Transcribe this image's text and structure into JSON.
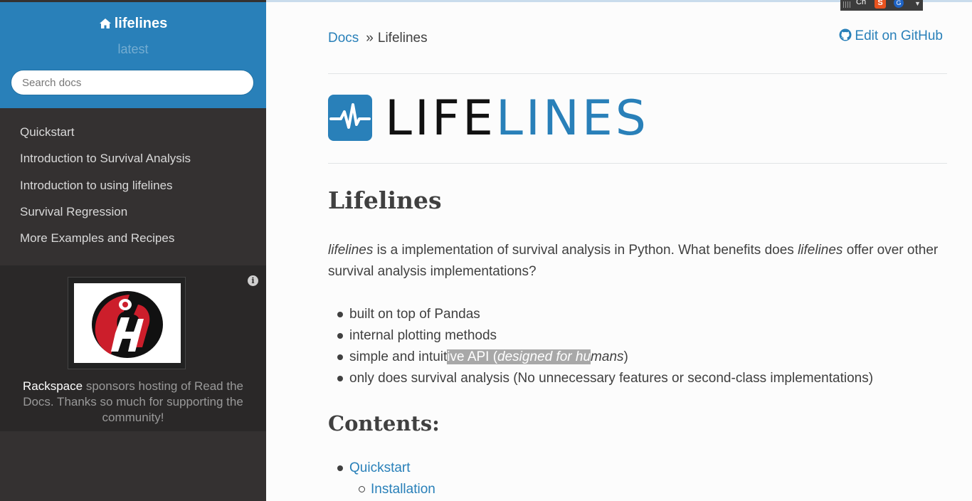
{
  "sidebar": {
    "brand": "lifelines",
    "version": "latest",
    "search_placeholder": "Search docs",
    "nav": [
      {
        "label": "Quickstart"
      },
      {
        "label": "Introduction to Survival Analysis"
      },
      {
        "label": "Introduction to using lifelines"
      },
      {
        "label": "Survival Regression"
      },
      {
        "label": "More Examples and Recipes"
      }
    ],
    "sponsor": {
      "name": "Rackspace",
      "text": " sponsors hosting of Read the Docs. Thanks so much for supporting the community!"
    }
  },
  "breadcrumb": {
    "root": "Docs",
    "separator": "»",
    "current": "Lifelines"
  },
  "edit_link": "Edit on GitHub",
  "logo": {
    "part1": "LIFE",
    "part2": "LINES",
    "color_dark": "#111111",
    "color_accent": "#2980b9"
  },
  "page": {
    "title": "Lifelines",
    "intro": {
      "em1": "lifelines",
      "mid": " is a implementation of survival analysis in Python. What benefits does ",
      "em2": "lifelines",
      "end": " offer over other survival analysis implementations?"
    },
    "bullets": {
      "b1": "built on top of Pandas",
      "b2": "internal plotting methods",
      "b3": {
        "pre": "simple and intuit",
        "hl1": "ive API (",
        "hl_em": "designed for hu",
        "em_rest": "mans",
        "close": ")"
      },
      "b4": "only does survival analysis (No unnecessary features or second-class implementations)"
    },
    "contents_heading": "Contents:",
    "toc": [
      {
        "label": "Quickstart",
        "level": 1
      },
      {
        "label": "Installation",
        "level": 2
      }
    ]
  },
  "ime_toolbar": {
    "lang": "Ch",
    "s_icon": "S",
    "g_icon": "G"
  },
  "colors": {
    "sidebar_top": "#2980b9",
    "sidebar_bg": "#343131",
    "link": "#2980b9",
    "text": "#404040"
  }
}
